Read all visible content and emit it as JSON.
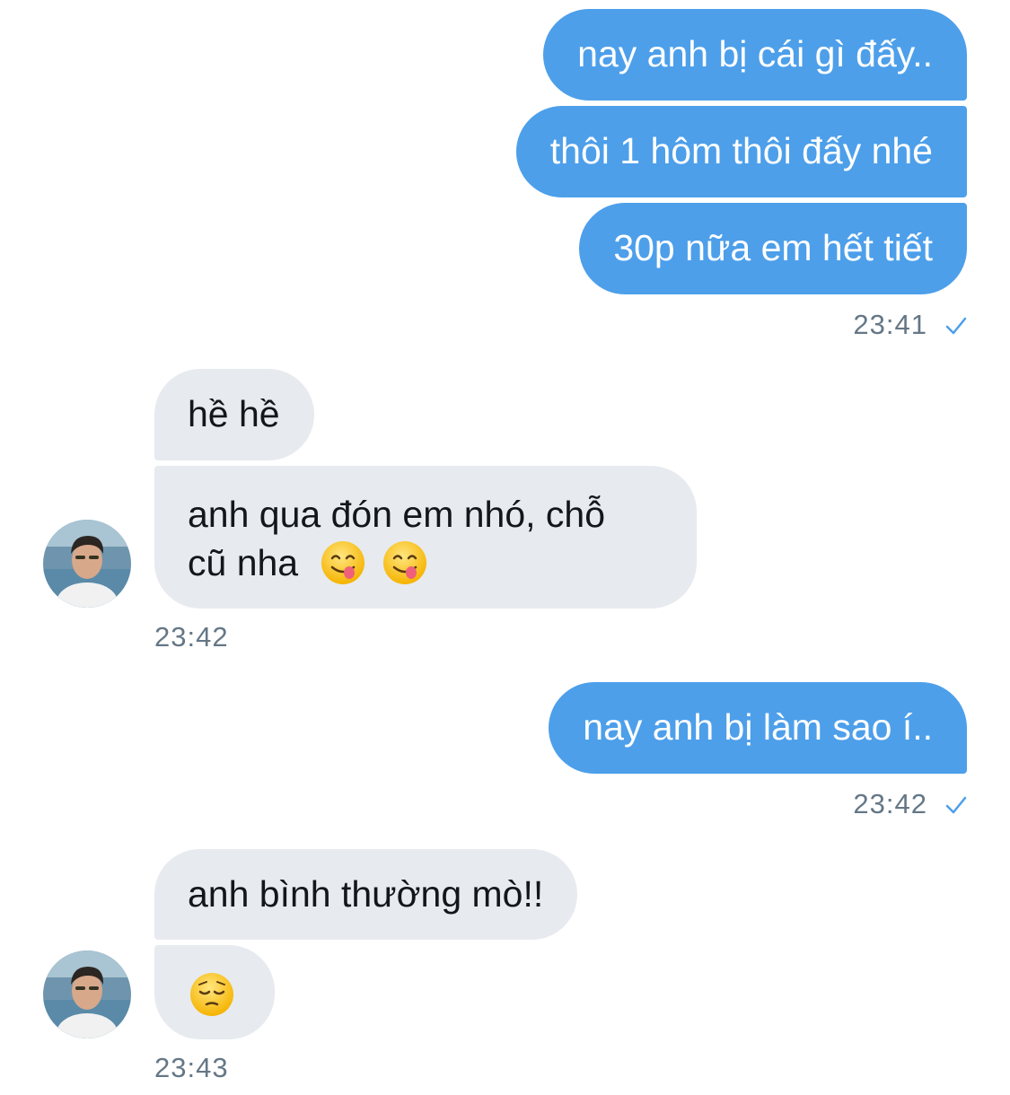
{
  "messages": {
    "m1": "nay anh bị cái gì đấy..",
    "m2": "thôi 1 hôm thôi đấy nhé",
    "m3": "30p nữa em hết tiết",
    "t1": "23:41",
    "m4": "hề hề",
    "m5_line1": "anh qua đón em nhó, chỗ",
    "m5_line2": "cũ nha",
    "t2": "23:42",
    "m6": "nay anh bị làm sao í..",
    "t3": "23:42",
    "m7": "anh bình thường mò!!",
    "t4": "23:43"
  },
  "emojis": {
    "m5": [
      "face-savoring-food-emoji",
      "face-savoring-food-emoji"
    ],
    "m8": [
      "pensive-face-emoji"
    ]
  },
  "colors": {
    "outgoing_bubble": "#4d9fea",
    "incoming_bubble": "#e7eaef",
    "timestamp": "#657786",
    "read_check": "#4d9fea"
  }
}
